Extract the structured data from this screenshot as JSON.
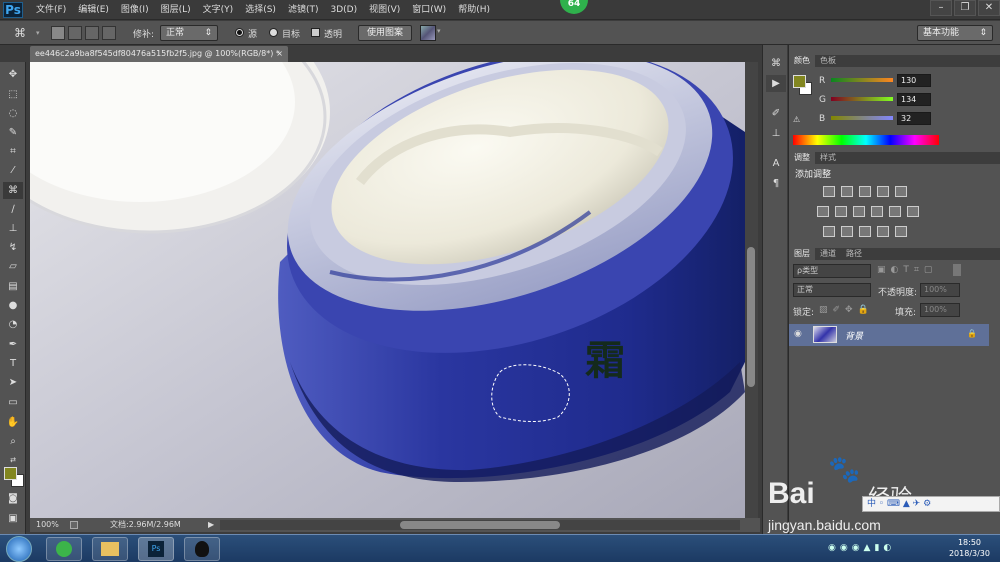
{
  "app": {
    "logo": "Ps",
    "badge": "64"
  },
  "menu": [
    "文件(F)",
    "编辑(E)",
    "图像(I)",
    "图层(L)",
    "文字(Y)",
    "选择(S)",
    "滤镜(T)",
    "3D(D)",
    "视图(V)",
    "窗口(W)",
    "帮助(H)"
  ],
  "window_controls": [
    "minimize-icon",
    "restore-icon",
    "close-icon"
  ],
  "options": {
    "patch_label": "修补:",
    "patch_mode": "正常",
    "source_label": "源",
    "dest_label": "目标",
    "transparent_label": "透明",
    "use_pattern_label": "使用图案",
    "workspace": "基本功能"
  },
  "document": {
    "tab_title": "ee446c2a9ba8f545df80476a515fb2f5.jpg @ 100%(RGB/8*) *",
    "close": "×",
    "zoom": "100%",
    "doc_size": "文档:2.96M/2.96M",
    "jar_text": "霜"
  },
  "color_panel": {
    "tabs": [
      "颜色",
      "色板"
    ],
    "channels": [
      {
        "label": "R",
        "value": "130"
      },
      {
        "label": "G",
        "value": "134"
      },
      {
        "label": "B",
        "value": "32"
      }
    ],
    "foreground": "#828620",
    "background": "#ffffff"
  },
  "adjust_panel": {
    "tabs": [
      "调整",
      "样式"
    ],
    "title": "添加调整"
  },
  "layers_panel": {
    "tabs": [
      "图层",
      "通道",
      "路径"
    ],
    "filter_label": "ρ类型",
    "blend_mode": "正常",
    "opacity_label": "不透明度:",
    "opacity_value": "100%",
    "lock_label": "锁定:",
    "fill_label": "填充:",
    "fill_value": "100%",
    "layer_name": "背景"
  },
  "taskbar": {
    "time": "18:50",
    "date": "2018/3/30"
  },
  "watermark": {
    "brand": "Bai",
    "brand2": "经验",
    "url": "jingyan.baidu.com"
  }
}
